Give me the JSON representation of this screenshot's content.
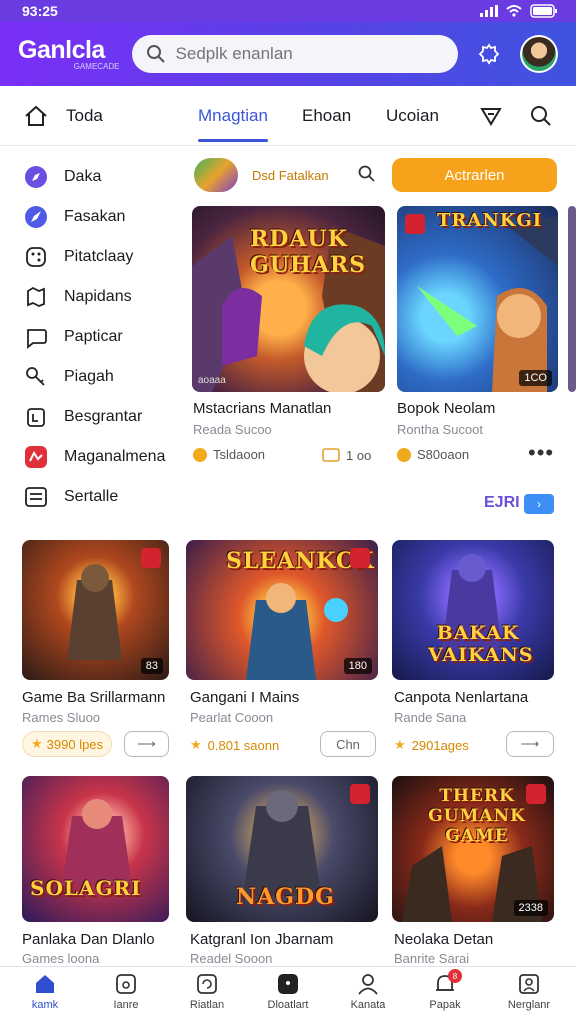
{
  "status": {
    "time": "93:25"
  },
  "header": {
    "logo": "Ganlcla",
    "logo_sub": "GAMECADE",
    "search_placeholder": "Sedplk enanlan"
  },
  "tabs": [
    {
      "label": "Toda"
    },
    {
      "label": "Mnagtian",
      "active": true
    },
    {
      "label": "Ehoan"
    },
    {
      "label": "Ucoian"
    }
  ],
  "sidebar": {
    "items": [
      {
        "label": "Daka",
        "icon": "compass-icon"
      },
      {
        "label": "Fasakan",
        "icon": "rocket-icon"
      },
      {
        "label": "Pitatclaay",
        "icon": "dice-icon"
      },
      {
        "label": "Napidans",
        "icon": "map-icon"
      },
      {
        "label": "Papticar",
        "icon": "chat-icon"
      },
      {
        "label": "Piagah",
        "icon": "key-icon"
      },
      {
        "label": "Besgrantar",
        "icon": "bag-icon"
      },
      {
        "label": "Maganalmena",
        "icon": "store-icon"
      },
      {
        "label": "Sertalle",
        "icon": "list-icon"
      }
    ]
  },
  "featured_toolbar": {
    "label": "Dsd Fatalkan",
    "cta": "Actrarlen"
  },
  "featured": [
    {
      "image_text": "RDAUK GUHARS",
      "title": "Mstacrians Manatlan",
      "subtitle": "Reada Sucoo",
      "price": "Tsldaoon",
      "meta": "1 oo",
      "badge_bl": "aoaaa",
      "badge_br": ""
    },
    {
      "image_text": "TRANKGI",
      "title": "Bopok Neolam",
      "subtitle": "Rontha Sucoot",
      "price": "S80oaon",
      "meta": "•••",
      "badge_bl": "",
      "badge_br": "1CO"
    }
  ],
  "pager": {
    "indicator": "EJRI",
    "next": "›"
  },
  "grid": [
    {
      "image_text": "",
      "title": "Game Ba Srillarmann",
      "subtitle": "Rames Sluoo",
      "price": "3990 lpes",
      "badge": "83"
    },
    {
      "image_text": "SLEANKCK",
      "title": "Gangani I Mains",
      "subtitle": "Pearlat Cooon",
      "price": "0.801 saonn",
      "badge": "180",
      "button": "Chn"
    },
    {
      "image_text": "BAKAK VAIKANS",
      "title": "Canpota Nenlartana",
      "subtitle": "Rande Sana",
      "price": "2901ages",
      "badge": ""
    },
    {
      "image_text": "SOLAGRI",
      "title": "Panlaka Dan Dlanlo",
      "subtitle": "Games loona",
      "price": "",
      "badge": ""
    },
    {
      "image_text": "NAGDG",
      "title": "Katgranl Ion Jbarnam",
      "subtitle": "Readel Sooon",
      "price": "",
      "badge": ""
    },
    {
      "image_text": "THERK GUMANK GAME",
      "title": "Neolaka Detan",
      "subtitle": "Banrite Sarai",
      "price": "",
      "badge": "2338"
    }
  ],
  "bottom_nav": [
    {
      "label": "kamk",
      "icon": "home-icon",
      "active": true
    },
    {
      "label": "Ianre",
      "icon": "square-icon"
    },
    {
      "label": "Riatlan",
      "icon": "refresh-icon"
    },
    {
      "label": "Dloatlart",
      "icon": "chat-bubble-icon"
    },
    {
      "label": "Kanata",
      "icon": "person-icon"
    },
    {
      "label": "Papak",
      "icon": "bell-icon",
      "badge": "8"
    },
    {
      "label": "Nerglanr",
      "icon": "profile-card-icon"
    }
  ]
}
